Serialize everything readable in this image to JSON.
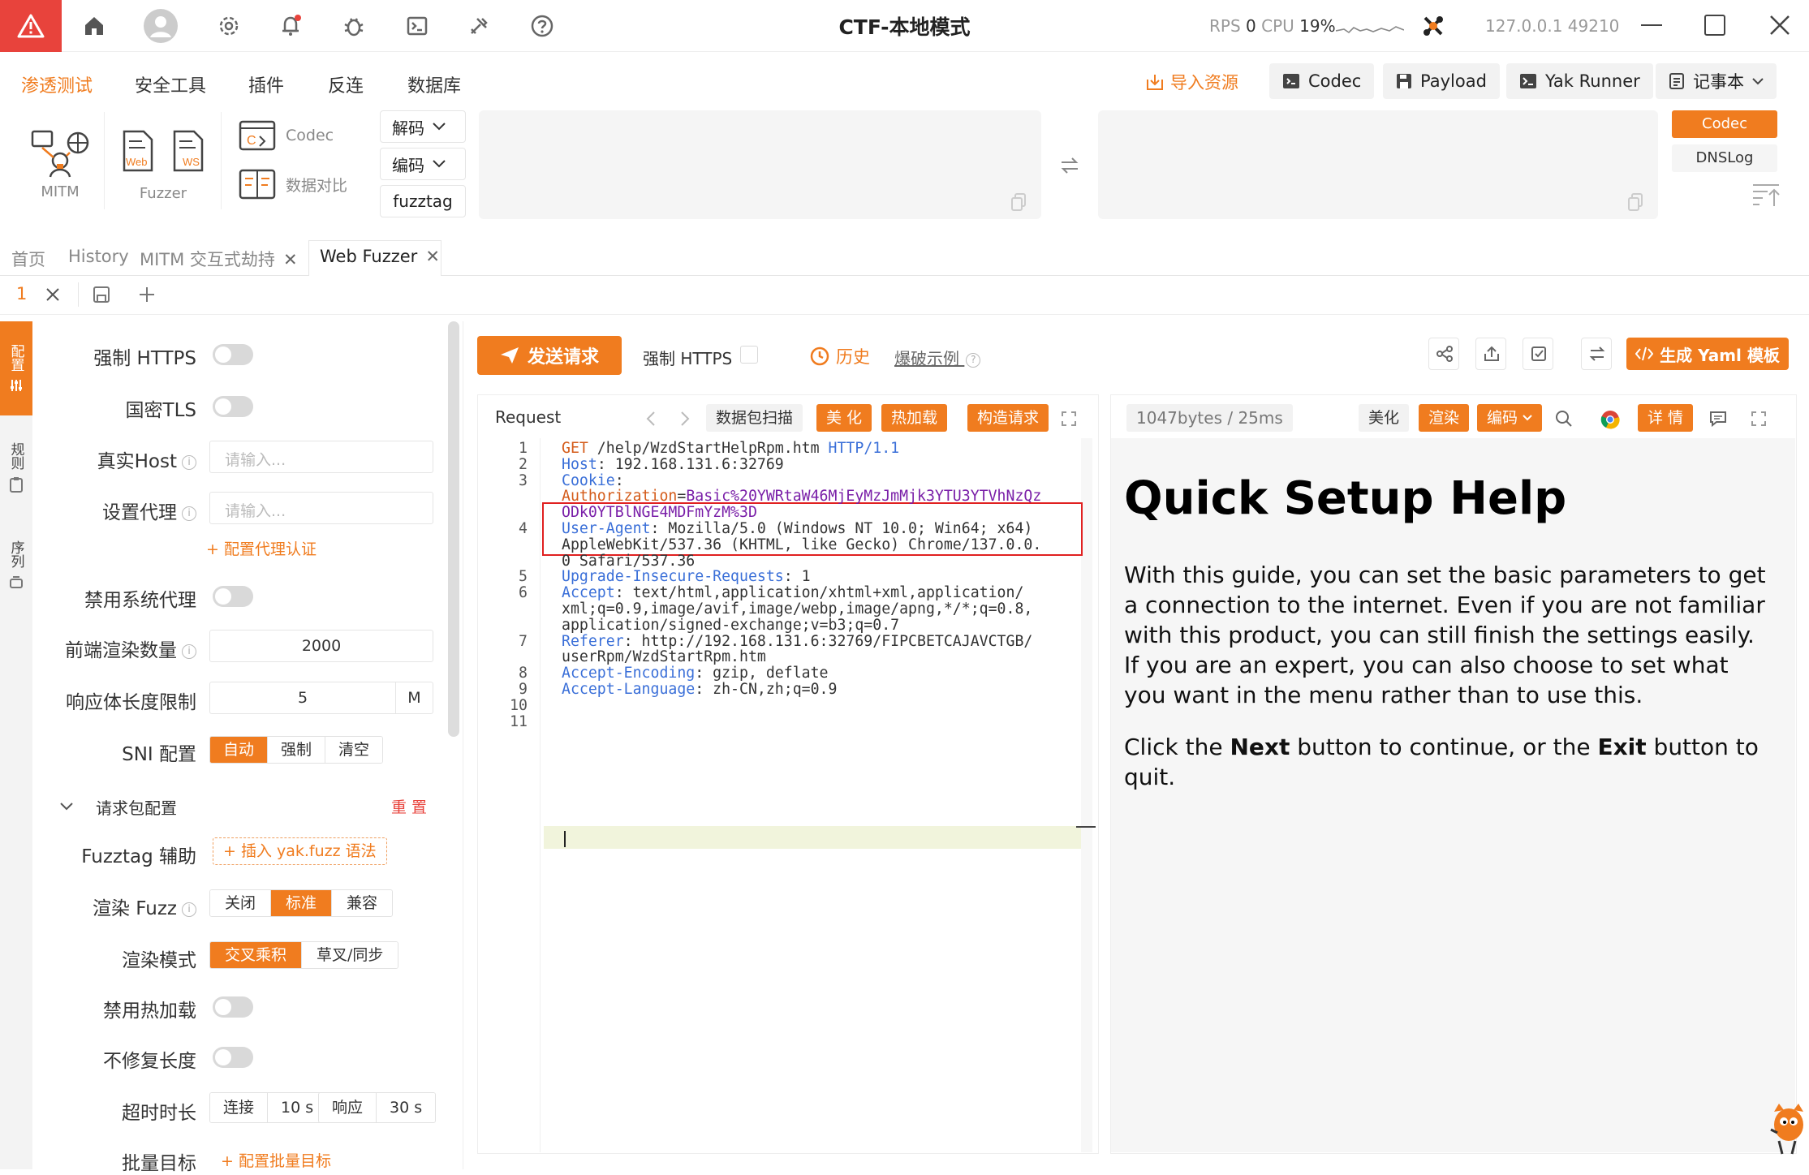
{
  "titlebar": {
    "title": "CTF-本地模式",
    "rps_label": "RPS",
    "rps_value": "0",
    "cpu_label": "CPU",
    "cpu_value": "19%",
    "address": "127.0.0.1 49210",
    "icons": [
      "warning-icon",
      "home-icon",
      "user-avatar-icon",
      "settings-icon",
      "bell-icon",
      "bug-icon",
      "terminal-icon",
      "tools-icon",
      "help-icon",
      "engine-logo-icon",
      "minimize-icon",
      "maximize-icon",
      "close-icon"
    ]
  },
  "menubar": {
    "items": [
      "渗透测试",
      "安全工具",
      "插件",
      "反连",
      "数据库"
    ],
    "import_label": "导入资源",
    "tools": [
      "Codec",
      "Payload",
      "Yak Runner",
      "记事本"
    ]
  },
  "toolbar": {
    "mitm_label": "MITM",
    "fuzzer_label": "Fuzzer",
    "codec_label": "Codec",
    "compare_label": "数据对比",
    "decode_label": "解码",
    "encode_label": "编码",
    "fuzztag_label": "fuzztag",
    "right_codec": "Codec",
    "right_dnslog": "DNSLog",
    "web_icon_text": "Web",
    "ws_icon_text": "WS"
  },
  "tabs": {
    "items": [
      "首页",
      "History",
      "MITM 交互式劫持",
      "Web Fuzzer"
    ],
    "sub_tab": "1"
  },
  "rail": {
    "items": [
      "配置",
      "规则",
      "序列"
    ]
  },
  "settings": {
    "force_https": "强制 HTTPS",
    "gm_tls": "国密TLS",
    "real_host": "真实Host",
    "real_host_placeholder": "请输入...",
    "proxy": "设置代理",
    "proxy_placeholder": "请输入...",
    "proxy_auth": "+ 配置代理认证",
    "disable_sys_proxy": "禁用系统代理",
    "render_count": "前端渲染数量",
    "render_count_value": "2000",
    "body_limit": "响应体长度限制",
    "body_limit_value": "5",
    "body_limit_unit": "M",
    "sni": "SNI 配置",
    "sni_options": [
      "自动",
      "强制",
      "清空"
    ],
    "sni_selected": 0,
    "section": "请求包配置",
    "reset": "重 置",
    "fuzztag_help": "Fuzztag 辅助",
    "insert_syntax": "+ 插入 yak.fuzz 语法",
    "render_fuzz": "渲染 Fuzz",
    "render_fuzz_options": [
      "关闭",
      "标准",
      "兼容"
    ],
    "render_fuzz_selected": 1,
    "render_mode": "渲染模式",
    "render_mode_options": [
      "交叉乘积",
      "草叉/同步"
    ],
    "render_mode_selected": 0,
    "disable_hotload": "禁用热加载",
    "no_fix_length": "不修复长度",
    "timeout": "超时时长",
    "connect_label": "连接",
    "connect_value": "10 s",
    "response_label": "响应",
    "response_value": "30 s",
    "batch_target": "批量目标",
    "batch_config": "+ 配置批量目标"
  },
  "action_bar": {
    "send": "发送请求",
    "force_https": "强制 HTTPS",
    "history": "历史",
    "example": "爆破示例",
    "gen_yaml": "生成 Yaml 模板"
  },
  "request": {
    "title": "Request",
    "scan": "数据包扫描",
    "beautify": "美 化",
    "hotload": "热加载",
    "construct": "构造请求",
    "lines": [
      {
        "n": "1",
        "segs": [
          [
            "m",
            "GET"
          ],
          [
            "v",
            " /help/WzdStartHelpRpm.htm "
          ],
          [
            "k",
            "HTTP/1.1"
          ]
        ]
      },
      {
        "n": "2",
        "segs": [
          [
            "k",
            "Host"
          ],
          [
            "v",
            ": 192.168.131.6:32769"
          ]
        ]
      },
      {
        "n": "3",
        "segs": [
          [
            "k",
            "Cookie"
          ],
          [
            "v",
            ":"
          ]
        ]
      },
      {
        "n": "",
        "segs": [
          [
            "m",
            "Authorization"
          ],
          [
            "v",
            "="
          ],
          [
            "p",
            "Basic%20YWRtaW46MjEyMzJmMjk3YTU3YTVhNzQz"
          ]
        ]
      },
      {
        "n": "",
        "segs": [
          [
            "p",
            "ODk0YTBlNGE4MDFmYzM%3D"
          ]
        ]
      },
      {
        "n": "4",
        "segs": [
          [
            "k",
            "User-Agent"
          ],
          [
            "v",
            ": Mozilla/5.0 (Windows NT 10.0; Win64; x64)"
          ]
        ]
      },
      {
        "n": "",
        "segs": [
          [
            "v",
            "AppleWebKit/537.36 (KHTML, like Gecko) Chrome/137.0.0."
          ]
        ]
      },
      {
        "n": "",
        "segs": [
          [
            "v",
            "0 Safari/537.36"
          ]
        ]
      },
      {
        "n": "5",
        "segs": [
          [
            "k",
            "Upgrade-Insecure-Requests"
          ],
          [
            "v",
            ": 1"
          ]
        ]
      },
      {
        "n": "6",
        "segs": [
          [
            "k",
            "Accept"
          ],
          [
            "v",
            ": text/html,application/xhtml+xml,application/"
          ]
        ]
      },
      {
        "n": "",
        "segs": [
          [
            "v",
            "xml;q=0.9,image/avif,image/webp,image/apng,*/*;q=0.8,"
          ]
        ]
      },
      {
        "n": "",
        "segs": [
          [
            "v",
            "application/signed-exchange;v=b3;q=0.7"
          ]
        ]
      },
      {
        "n": "7",
        "segs": [
          [
            "k",
            "Referer"
          ],
          [
            "v",
            ": http://192.168.131.6:32769/FIPCBETCAJAVCTGB/"
          ]
        ]
      },
      {
        "n": "",
        "segs": [
          [
            "v",
            "userRpm/WzdStartRpm.htm"
          ]
        ]
      },
      {
        "n": "8",
        "segs": [
          [
            "k",
            "Accept-Encoding"
          ],
          [
            "v",
            ": gzip, deflate"
          ]
        ]
      },
      {
        "n": "9",
        "segs": [
          [
            "k",
            "Accept-Language"
          ],
          [
            "v",
            ": zh-CN,zh;q=0.9"
          ]
        ]
      },
      {
        "n": "10",
        "segs": []
      },
      {
        "n": "11",
        "segs": []
      }
    ]
  },
  "response": {
    "size": "1047bytes / 25ms",
    "beautify": "美化",
    "render": "渲染",
    "encode": "编码",
    "details": "详 情",
    "heading": "Quick Setup Help",
    "para1": "With this guide, you can set the basic parameters to get a connection to the internet. Even if you are not familiar with this product, you can still finish the settings easily. If you are an expert, you can also choose to set what you want in the menu rather than to use this.",
    "para2_a": "Click the ",
    "para2_next": "Next",
    "para2_b": " button to continue, or the ",
    "para2_exit": "Exit",
    "para2_c": " button to quit."
  },
  "colors": {
    "accent": "#f07c1f",
    "danger": "#e8433c",
    "key": "#3a6fd8",
    "method": "#d45c1b",
    "param": "#7a1fa8"
  }
}
